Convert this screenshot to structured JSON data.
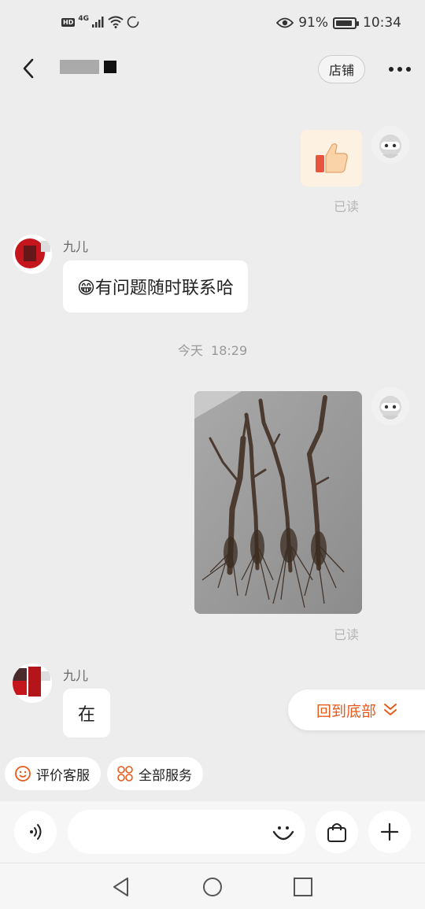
{
  "status_bar": {
    "network": "4G",
    "battery": "91%",
    "battery_level": 0.91,
    "time": "10:34"
  },
  "header": {
    "shop_button_label": "店铺"
  },
  "messages": [
    {
      "sender": "me",
      "type": "image",
      "content": "thumbs-up sticker",
      "read_label": "已读"
    },
    {
      "sender": "shop",
      "nickname": "九儿",
      "type": "text",
      "text": "😁有问题随时联系哈"
    },
    {
      "sender": "system",
      "type": "time",
      "day": "今天",
      "time": "18:29"
    },
    {
      "sender": "me",
      "type": "image",
      "content": "photo of grapevine cuttings with roots",
      "read_label": "已读"
    },
    {
      "sender": "shop",
      "nickname": "九儿",
      "type": "text",
      "text": "在"
    }
  ],
  "scroll_to_bottom_label": "回到底部",
  "quick_actions": [
    {
      "label": "评价客服",
      "icon": "smile-icon"
    },
    {
      "label": "全部服务",
      "icon": "grid-icon"
    }
  ],
  "input": {
    "placeholder": ""
  },
  "colors": {
    "accent": "#e85a1c",
    "background": "#ededed",
    "bubble": "#ffffff"
  }
}
